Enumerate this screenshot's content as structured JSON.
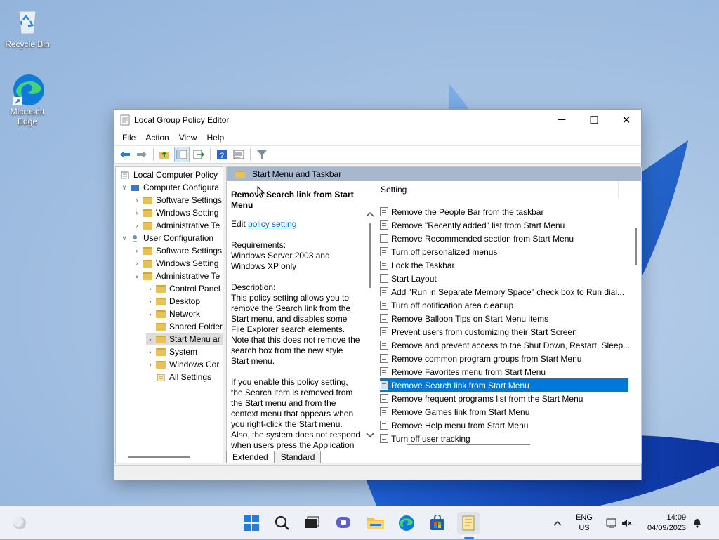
{
  "desktop": {
    "icons": [
      {
        "label": "Recycle Bin"
      },
      {
        "label": "Microsoft Edge"
      }
    ]
  },
  "window": {
    "title": "Local Group Policy Editor",
    "controls": {
      "minimize": "─",
      "maximize": "☐",
      "close": "✕"
    },
    "menu": [
      "File",
      "Action",
      "View",
      "Help"
    ]
  },
  "tree": {
    "items": [
      {
        "label": "Local Computer Policy"
      },
      {
        "label": "Computer Configura"
      },
      {
        "label": "Software Settings"
      },
      {
        "label": "Windows Setting"
      },
      {
        "label": "Administrative Te"
      },
      {
        "label": "User Configuration"
      },
      {
        "label": "Software Settings"
      },
      {
        "label": "Windows Setting"
      },
      {
        "label": "Administrative Te"
      },
      {
        "label": "Control Panel"
      },
      {
        "label": "Desktop"
      },
      {
        "label": "Network"
      },
      {
        "label": "Shared Folder"
      },
      {
        "label": "Start Menu ar"
      },
      {
        "label": "System"
      },
      {
        "label": "Windows Cor"
      },
      {
        "label": "All Settings"
      }
    ]
  },
  "content": {
    "header": "Start Menu and Taskbar",
    "desc_title": "Remove Search link from Start Menu",
    "edit_prefix": "Edit ",
    "edit_link": "policy setting",
    "requirements_label": "Requirements:",
    "requirements": "Windows Server 2003 and Windows XP only",
    "description_label": "Description:",
    "description": "This policy setting allows you to remove the Search link from the Start menu, and disables some File Explorer search elements.  Note that this does not remove the search box from the new style Start menu.",
    "description2": "If you enable this policy setting, the Search item is removed from the Start menu and from the context menu that appears when you right-click the Start menu. Also, the system does not respond when users press the Application"
  },
  "settings": {
    "column": "Setting",
    "rows": [
      "Remove the People Bar from the taskbar",
      "Remove \"Recently added\" list from Start Menu",
      "Remove Recommended section from Start Menu",
      "Turn off personalized menus",
      "Lock the Taskbar",
      "Start Layout",
      "Add \"Run in Separate Memory Space\" check box to Run dial...",
      "Turn off notification area cleanup",
      "Remove Balloon Tips on Start Menu items",
      "Prevent users from customizing their Start Screen",
      "Remove and prevent access to the Shut Down, Restart, Sleep...",
      "Remove common program groups from Start Menu",
      "Remove Favorites menu from Start Menu",
      "Remove Search link from Start Menu",
      "Remove frequent programs list from the Start Menu",
      "Remove Games link from Start Menu",
      "Remove Help menu from Start Menu",
      "Turn off user tracking"
    ],
    "selected_index": 13
  },
  "tabs": [
    "Extended",
    "Standard"
  ],
  "tray": {
    "language": "ENG",
    "region": "US",
    "time": "14:09",
    "date": "04/09/2023"
  },
  "colors": {
    "selection": "#0078d7",
    "header_band": "#a7b7cd",
    "link": "#0066cc"
  }
}
